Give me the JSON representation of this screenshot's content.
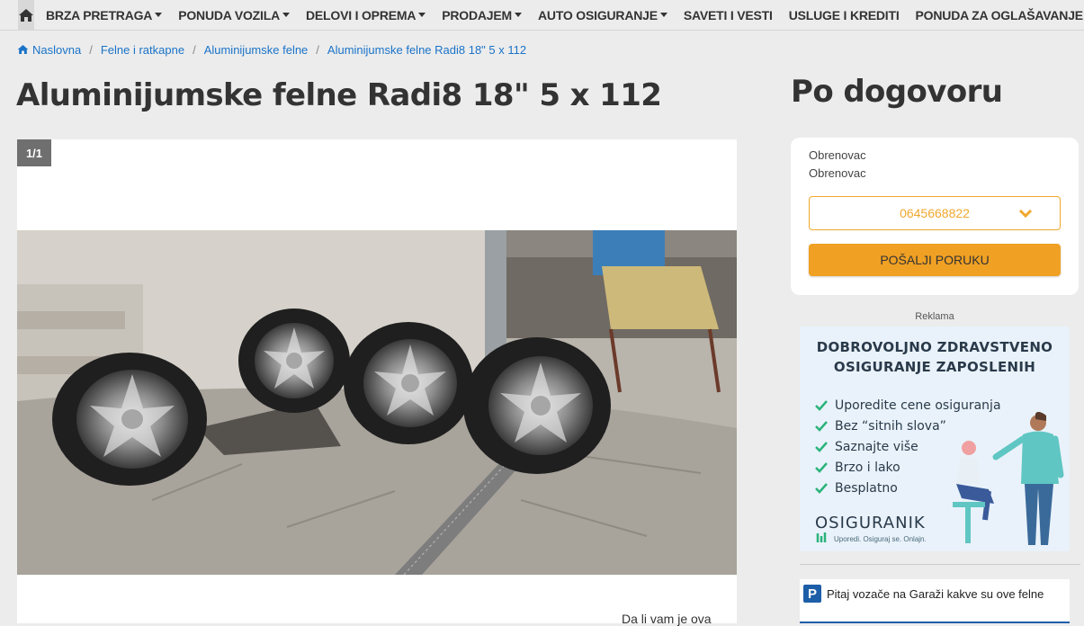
{
  "nav": {
    "home_icon": "home-icon",
    "items": [
      {
        "label": "BRZA PRETRAGA",
        "dropdown": true
      },
      {
        "label": "PONUDA VOZILA",
        "dropdown": true
      },
      {
        "label": "DELOVI I OPREMA",
        "dropdown": true
      },
      {
        "label": "PRODAJEM",
        "dropdown": true
      },
      {
        "label": "AUTO OSIGURANJE",
        "dropdown": true
      },
      {
        "label": "SAVETI I VESTI",
        "dropdown": false
      },
      {
        "label": "USLUGE I KREDITI",
        "dropdown": false
      },
      {
        "label": "PONUDA ZA OGLAŠAVANJE",
        "dropdown": false
      }
    ]
  },
  "breadcrumb": [
    "Naslovna",
    "Felne i ratkapne",
    "Aluminijumske felne",
    "Aluminijumske felne Radi8 18\" 5 x 112"
  ],
  "listing": {
    "title": "Aluminijumske felne Radi8 18\" 5 x 112",
    "price": "Po dogovoru",
    "image_counter": "1/1",
    "description_snippet": "Da li vam je ova"
  },
  "contact": {
    "location_1": "Obrenovac",
    "location_2": "Obrenovac",
    "phone": "0645668822",
    "send_button": "POŠALJI PORUKU"
  },
  "ad": {
    "label": "Reklama",
    "headline_1": "DOBROVOLJNO ZDRAVSTVENO",
    "headline_2": "OSIGURANJE ZAPOSLENIH",
    "bullets": [
      "Uporedite cene osiguranja",
      "Bez “sitnih slova”",
      "Saznajte više",
      "Brzo i lako",
      "Besplatno"
    ],
    "brand": "OSIGURANIK",
    "tagline": "Uporedi. Osiguraj se. Onlajn."
  },
  "forum": {
    "text": "Pitaj vozače na Garaži kakve su ove felne",
    "badge": "P"
  },
  "colors": {
    "accent_orange": "#f0a023",
    "link_blue": "#1a73c8",
    "forum_blue": "#1d5ea8"
  }
}
